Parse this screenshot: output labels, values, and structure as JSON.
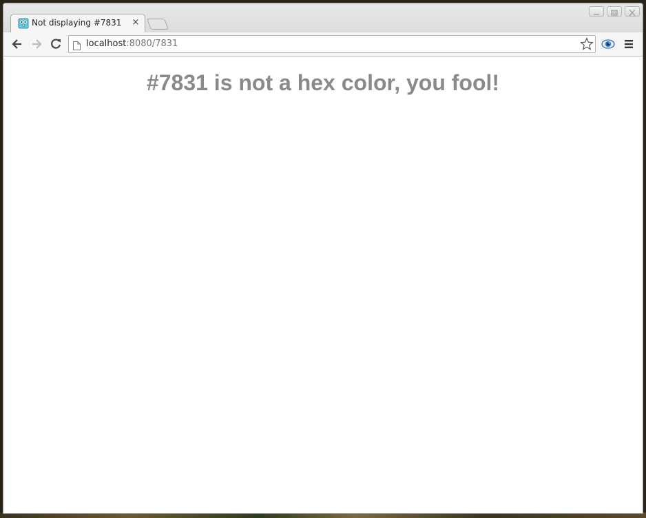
{
  "tab": {
    "title": "Not displaying #7831",
    "close_glyph": "×",
    "favicon_icon": "gopher-icon"
  },
  "window_controls": [
    "minimize-icon",
    "maximize-icon",
    "close-icon"
  ],
  "toolbar": {
    "back_icon": "back-arrow-icon",
    "forward_icon": "forward-arrow-icon",
    "reload_icon": "reload-icon",
    "url_host": "localhost",
    "url_rest": ":8080/7831",
    "bookmark_icon": "star-icon",
    "extension_icon": "eye-icon",
    "menu_icon": "menu-icon"
  },
  "page": {
    "headline": "#7831 is not a hex color, you fool!"
  },
  "colors": {
    "headline": "#8a8a8a",
    "favicon": "#5dc9e2"
  }
}
